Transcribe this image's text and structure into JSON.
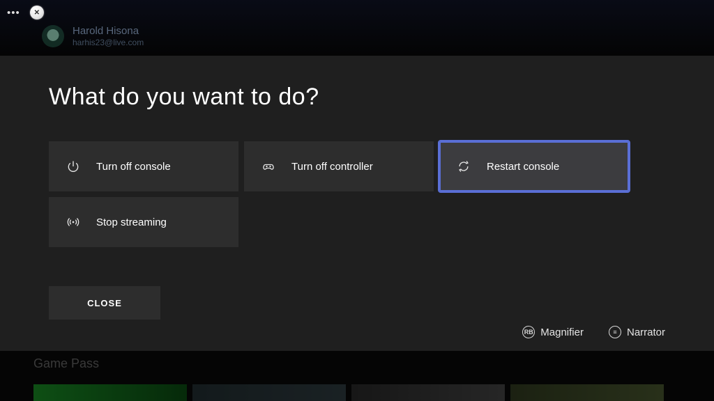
{
  "profile": {
    "name": "Harold Hisona",
    "email": "harhis23@live.com"
  },
  "title": "What do you want to do?",
  "tiles": {
    "power_off": {
      "label": "Turn off console"
    },
    "controller": {
      "label": "Turn off controller"
    },
    "restart": {
      "label": "Restart console"
    },
    "stop_stream": {
      "label": "Stop streaming"
    }
  },
  "close_label": "CLOSE",
  "tools": {
    "magnifier": "Magnifier",
    "narrator": "Narrator",
    "mag_key": "RB",
    "nar_key": "≡"
  },
  "background": {
    "section_label": "Game Pass"
  }
}
